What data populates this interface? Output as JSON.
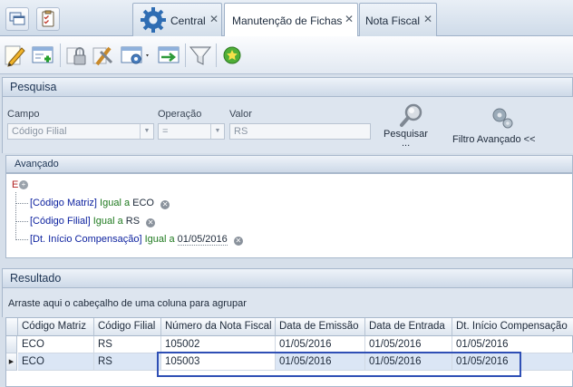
{
  "tabs": [
    {
      "label": "Central",
      "close": "✕"
    },
    {
      "label": "Manutenção de Fichas",
      "close": "✕"
    },
    {
      "label": "Nota Fiscal",
      "close": "✕"
    }
  ],
  "pesquisa": {
    "title": "Pesquisa",
    "campo_label": "Campo",
    "campo_value": "Código Filial",
    "operacao_label": "Operação",
    "operacao_value": "=",
    "valor_label": "Valor",
    "valor_value": "RS",
    "pesquisar_label": "Pesquisar",
    "pesquisar_ellipsis": "...",
    "filtro_avancado_label": "Filtro Avançado <<"
  },
  "avancado": {
    "title": "Avançado",
    "root_operator": "E",
    "conditions": [
      {
        "field": "[Código Matriz]",
        "operator": "Igual a",
        "value": "ECO"
      },
      {
        "field": "[Código Filial]",
        "operator": "Igual a",
        "value": "RS"
      },
      {
        "field": "[Dt. Início Compensação]",
        "operator": "Igual a",
        "value": "01/05/2016"
      }
    ]
  },
  "resultado": {
    "title": "Resultado",
    "group_hint": "Arraste aqui o cabeçalho de uma coluna para agrupar",
    "columns": [
      "Código Matriz",
      "Código Filial",
      "Número da Nota Fiscal",
      "Data de Emissão",
      "Data de Entrada",
      "Dt. Início Compensação"
    ],
    "rows": [
      [
        "ECO",
        "RS",
        "105002",
        "01/05/2016",
        "01/05/2016",
        "01/05/2016"
      ],
      [
        "ECO",
        "RS",
        "105003",
        "01/05/2016",
        "01/05/2016",
        "01/05/2016"
      ]
    ],
    "current_row_marker": "▶"
  },
  "colors": {
    "highlight_box": "#2f4fb5",
    "selected_row": "#dbe6f5",
    "condition_field": "#0a1f9e",
    "condition_operator": "#1f7a1f"
  }
}
